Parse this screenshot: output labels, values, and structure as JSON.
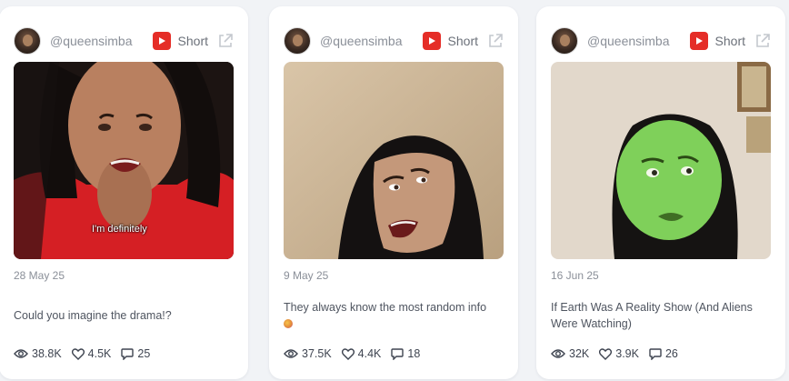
{
  "cards": [
    {
      "handle": "@queensimba",
      "type_label": "Short",
      "date": "28 May 25",
      "caption": "Could you imagine the drama!?",
      "subtitle": "I'm definitely",
      "views": "38.8K",
      "likes": "4.5K",
      "comments": "25"
    },
    {
      "handle": "@queensimba",
      "type_label": "Short",
      "date": "9 May 25",
      "caption": "They always know the most random info",
      "views": "37.5K",
      "likes": "4.4K",
      "comments": "18"
    },
    {
      "handle": "@queensimba",
      "type_label": "Short",
      "date": "16 Jun 25",
      "caption": "If Earth Was A Reality Show (And Aliens Were Watching)",
      "views": "32K",
      "likes": "3.9K",
      "comments": "26"
    }
  ],
  "colors": {
    "background": "#f1f3f6",
    "card": "#ffffff",
    "youtube_red": "#e52d27",
    "muted_text": "#8a8f98"
  },
  "icons": [
    "avatar",
    "youtube-icon",
    "external-link-icon",
    "eye-icon",
    "heart-icon",
    "comment-icon"
  ]
}
